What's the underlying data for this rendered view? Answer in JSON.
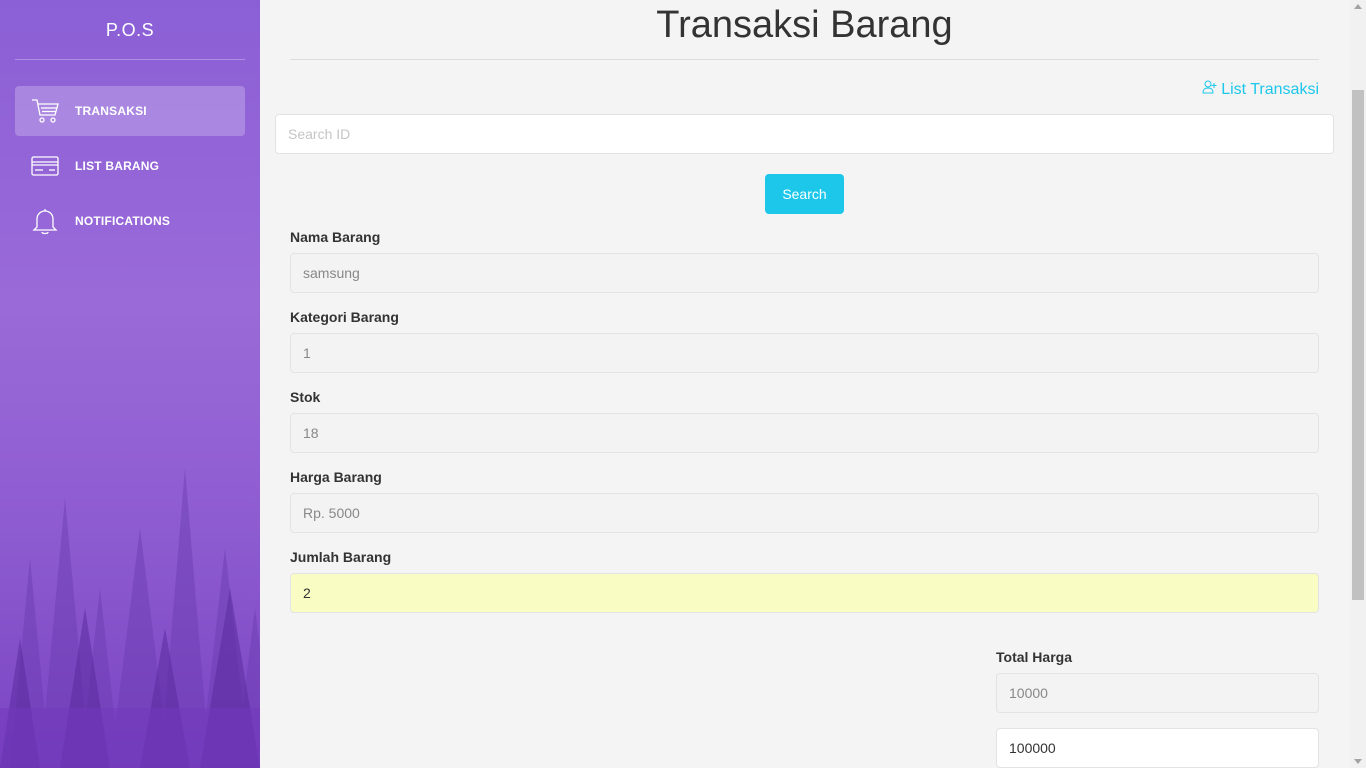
{
  "sidebar": {
    "brand": "P.O.S",
    "items": [
      {
        "label": "TRANSAKSI",
        "icon": "cart-icon",
        "active": true
      },
      {
        "label": "LIST BARANG",
        "icon": "credit-card-icon",
        "active": false
      },
      {
        "label": "NOTIFICATIONS",
        "icon": "bell-icon",
        "active": false
      }
    ]
  },
  "main": {
    "title": "Transaksi Barang",
    "list_link": "List Transaksi",
    "search": {
      "placeholder": "Search ID",
      "value": "",
      "button": "Search"
    },
    "fields": [
      {
        "label": "Nama Barang",
        "value": "samsung"
      },
      {
        "label": "Kategori Barang",
        "value": "1"
      },
      {
        "label": "Stok",
        "value": "18"
      },
      {
        "label": "Harga Barang",
        "value": "Rp. 5000"
      },
      {
        "label": "Jumlah Barang",
        "value": "2"
      }
    ],
    "total": {
      "label": "Total Harga",
      "value": "10000",
      "payment_value": "100000"
    }
  },
  "colors": {
    "accent": "#1dc7ea",
    "sidebar": "#8b5fd6",
    "highlight_field": "#fafdc3"
  }
}
